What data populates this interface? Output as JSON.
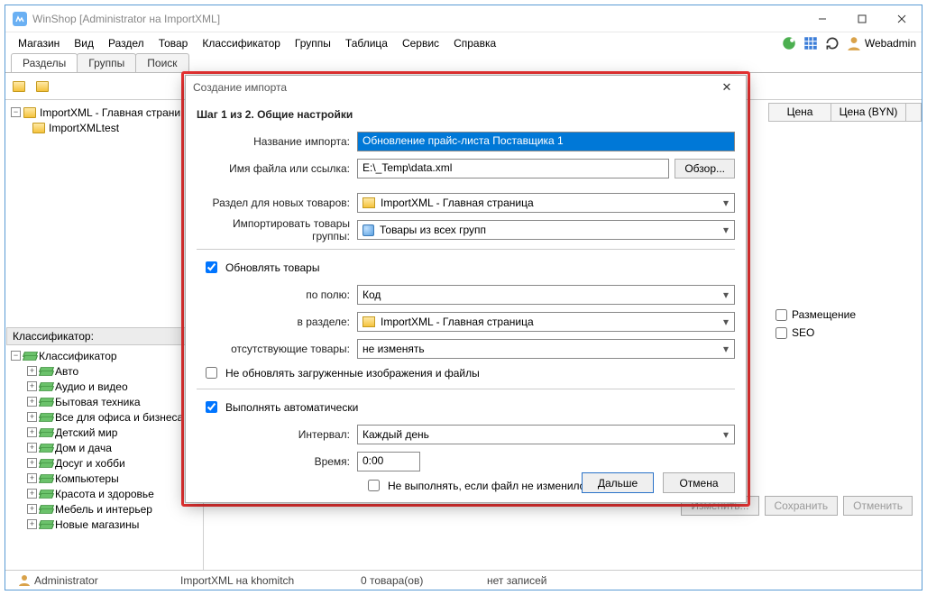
{
  "window": {
    "title": "WinShop [Administrator на ImportXML]"
  },
  "menu": [
    "Магазин",
    "Вид",
    "Раздел",
    "Товар",
    "Классификатор",
    "Группы",
    "Таблица",
    "Сервис",
    "Справка"
  ],
  "menu_right_user": "Webadmin",
  "tabs": [
    "Разделы",
    "Группы",
    "Поиск"
  ],
  "tree": {
    "root": "ImportXML - Главная страни",
    "child": "ImportXMLtest"
  },
  "classifier": {
    "header": "Классификатор:",
    "root": "Классификатор",
    "items": [
      "Авто",
      "Аудио и видео",
      "Бытовая техника",
      "Все для офиса и бизнеса",
      "Детский мир",
      "Дом и дача",
      "Досуг и хобби",
      "Компьютеры",
      "Красота и здоровье",
      "Мебель и интерьер",
      "Новые магазины"
    ]
  },
  "table_headers": [
    "Цена",
    "Цена (BYN)"
  ],
  "side_checks": {
    "placement": "Размещение",
    "seo": "SEO"
  },
  "bottom_buttons": {
    "edit": "Изменить...",
    "save": "Сохранить",
    "cancel": "Отменить"
  },
  "statusbar": {
    "user": "Administrator",
    "host": "ImportXML на khomitch",
    "goods": "0 товара(ов)",
    "records": "нет записей"
  },
  "modal": {
    "title": "Создание импорта",
    "step": "Шаг 1 из 2. Общие настройки",
    "labels": {
      "name": "Название импорта:",
      "file": "Имя файла или ссылка:",
      "section": "Раздел для новых товаров:",
      "group": "Импортировать товары группы:",
      "byfield": "по полю:",
      "insection": "в разделе:",
      "missing": "отсутствующие товары:",
      "interval": "Интервал:",
      "time": "Время:"
    },
    "values": {
      "name": "Обновление прайс-листа Поставщика 1",
      "file": "E:\\_Temp\\data.xml",
      "section": "ImportXML - Главная страница",
      "group": "Товары из всех групп",
      "byfield": "Код",
      "insection": "ImportXML - Главная страница",
      "missing": "не изменять",
      "interval": "Каждый день",
      "time": "0:00"
    },
    "checks": {
      "update": "Обновлять товары",
      "noimg": "Не обновлять загруженные изображения и файлы",
      "auto": "Выполнять автоматически",
      "skip_unchanged": "Не выполнять, если файл не изменился"
    },
    "buttons": {
      "browse": "Обзор...",
      "next": "Дальше",
      "cancel": "Отмена"
    }
  }
}
